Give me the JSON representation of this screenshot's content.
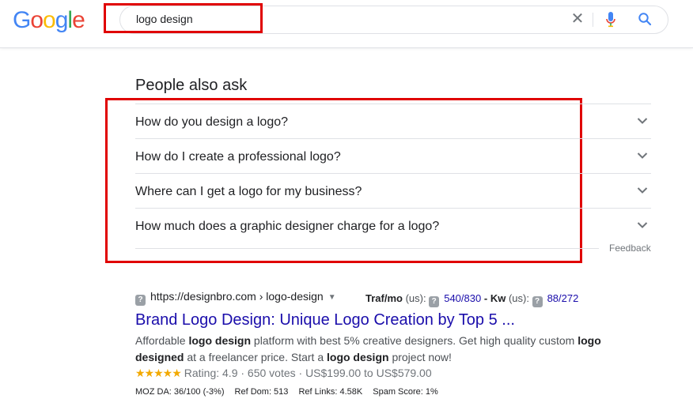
{
  "header": {
    "logo_letters": [
      {
        "ch": "G",
        "color": "#4285F4"
      },
      {
        "ch": "o",
        "color": "#EA4335"
      },
      {
        "ch": "o",
        "color": "#FBBC05"
      },
      {
        "ch": "g",
        "color": "#4285F4"
      },
      {
        "ch": "l",
        "color": "#34A853"
      },
      {
        "ch": "e",
        "color": "#EA4335"
      }
    ],
    "search": {
      "value": "logo design"
    },
    "icons": {
      "clear": "close-icon",
      "voice": "microphone-icon",
      "search": "search-icon"
    }
  },
  "paa": {
    "title": "People also ask",
    "questions": [
      "How do you design a logo?",
      "How do I create a professional logo?",
      "Where can I get a logo for my business?",
      "How much does a graphic designer charge for a logo?"
    ],
    "feedback": "Feedback"
  },
  "result": {
    "url": "https://designbro.com › logo-design",
    "traffic_label": "Traf/mo",
    "traffic_region": "(us):",
    "traffic_value": "540/830",
    "dash": "-",
    "kw_label": "Kw",
    "kw_region": "(us):",
    "kw_value": "88/272",
    "title": "Brand Logo Design: Unique Logo Creation by Top 5 ...",
    "snippet": {
      "p1": "Affordable ",
      "b1": "logo design",
      "p2": " platform with best 5% creative designers. Get high quality custom ",
      "b2": "logo designed",
      "p3": " at a freelancer price. Start a ",
      "b3": "logo design",
      "p4": " project now!"
    },
    "stars": "★★★★★",
    "rating_text": "Rating: 4.9 · 650 votes · US$199.00 to US$579.00",
    "moz": {
      "da": "MOZ DA: 36/100 (-3%)",
      "ref_dom": "Ref Dom: 513",
      "ref_links": "Ref Links: 4.58K",
      "spam": "Spam Score: 1%"
    }
  },
  "colors": {
    "annotation_red": "#E00000",
    "link": "#1A0DAB",
    "star": "#F2A900"
  }
}
